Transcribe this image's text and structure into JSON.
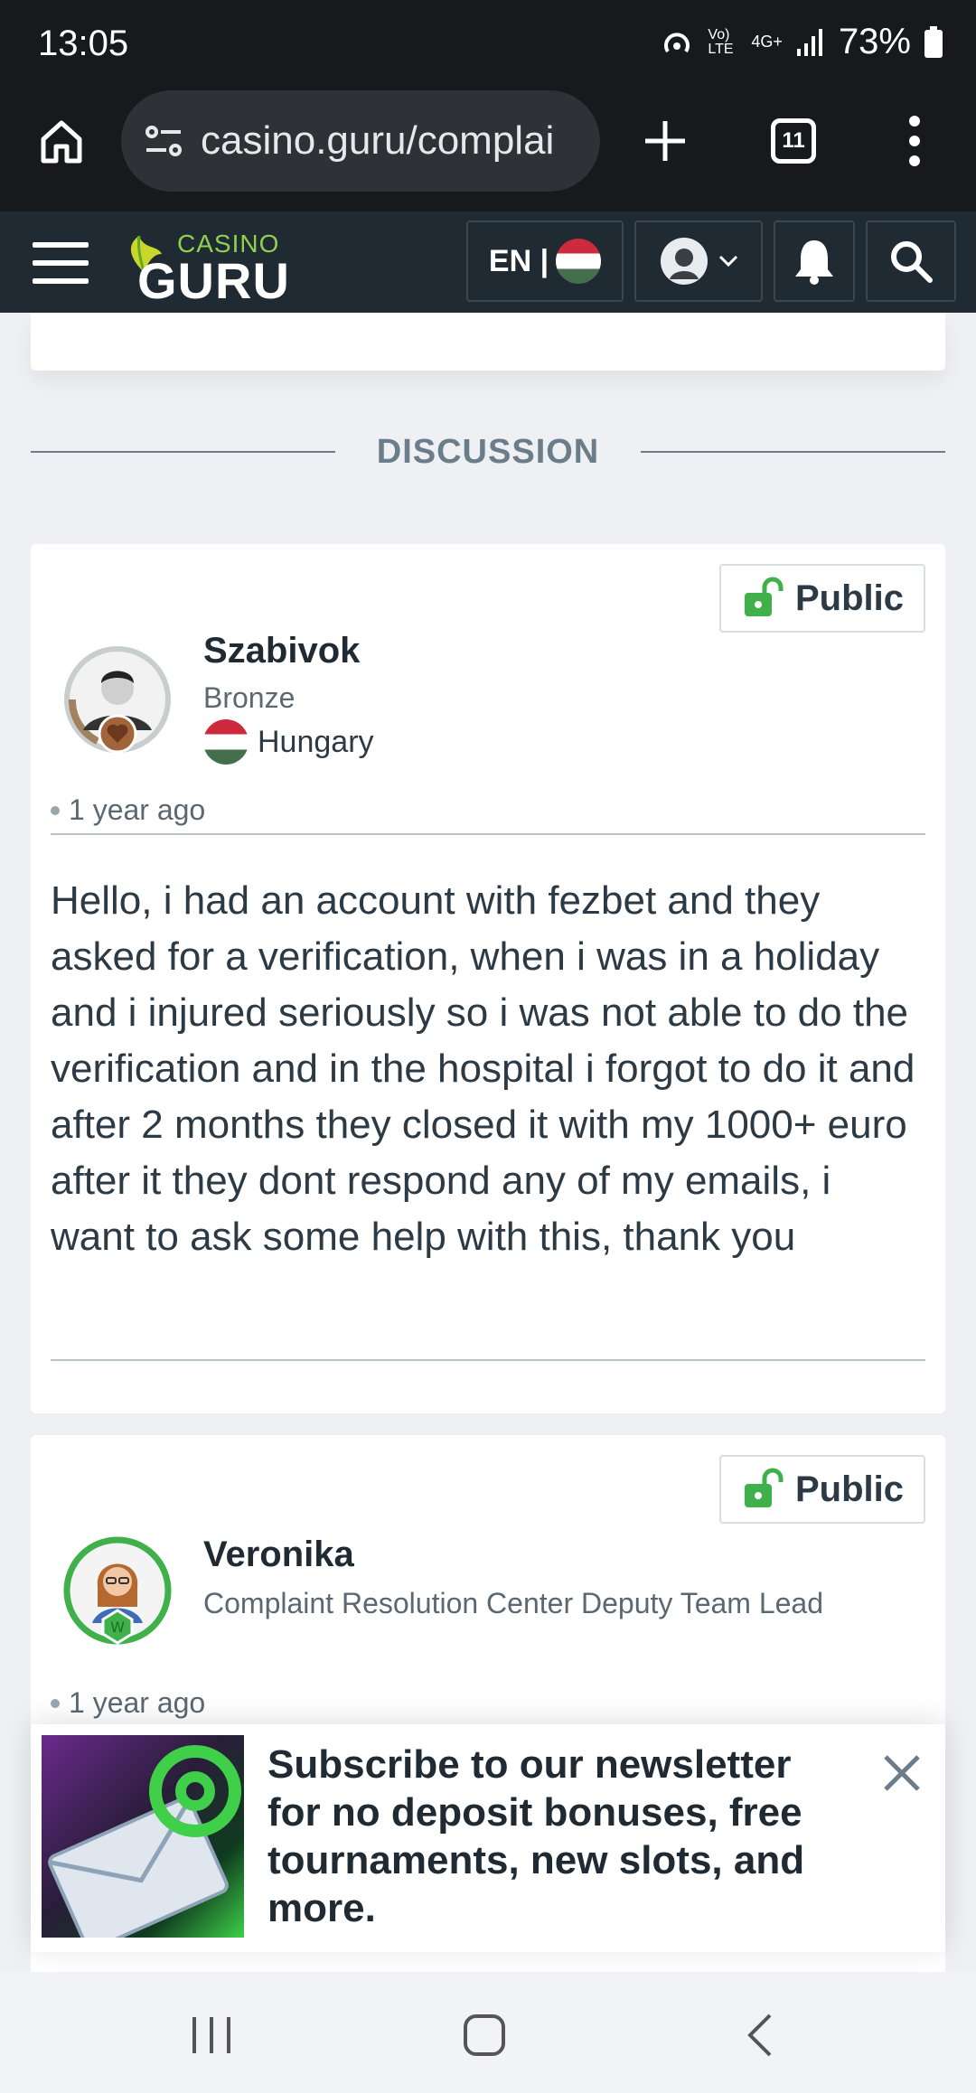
{
  "status_bar": {
    "time": "13:05",
    "network": "4G+",
    "volte": "Vo) LTE",
    "battery": "73%"
  },
  "browser": {
    "url": "casino.guru/complai",
    "tab_count": "11"
  },
  "site_nav": {
    "logo_top": "CASINO",
    "logo_main": "GURU",
    "language": "EN |"
  },
  "discussion": {
    "heading": "DISCUSSION"
  },
  "posts": [
    {
      "visibility": "Public",
      "author": "Szabivok",
      "rank": "Bronze",
      "country": "Hungary",
      "time_ago": "1 year ago",
      "message": "Hello, i had an account with fezbet and they asked for a verification, when i was in a holiday and i injured seriously so i was not able to do the verification and in the hospital i forgot to do it and after 2 months they closed it with my 1000+ euro after it they dont respond any of my emails, i want to ask some help with this, thank you"
    },
    {
      "visibility": "Public",
      "author": "Veronika",
      "role": "Complaint Resolution Center Deputy Team Lead",
      "time_ago": "1 year ago"
    }
  ],
  "newsletter": {
    "text": "Subscribe to our newsletter for no deposit bonuses, free tournaments, new slots, and more."
  },
  "colors": {
    "dark_header": "#17191c",
    "site_nav": "#1f2a33",
    "accent_green": "#3fb04a",
    "background": "#eef0f4"
  }
}
